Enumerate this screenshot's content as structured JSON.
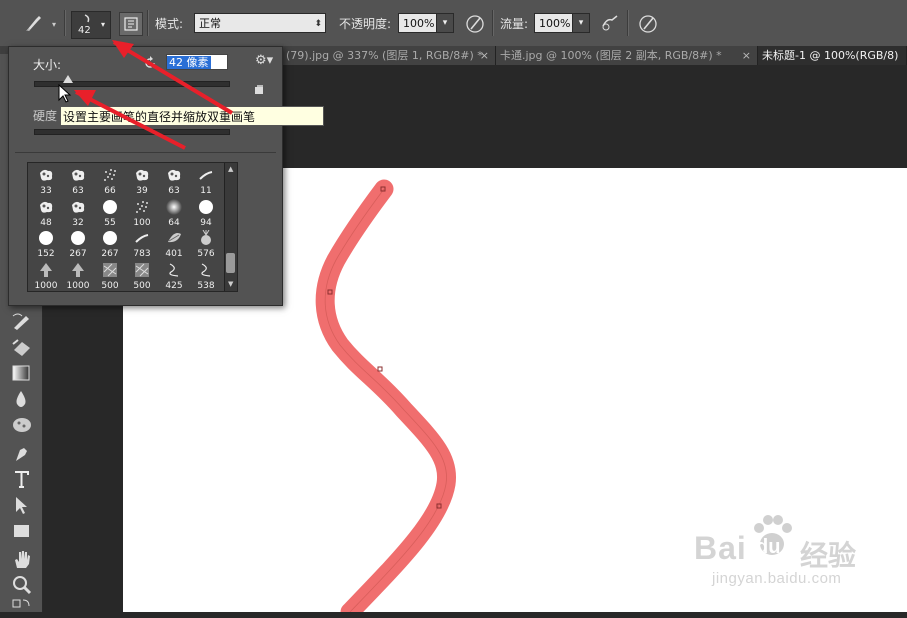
{
  "options_bar": {
    "brush_size_value": "42",
    "mode_label": "模式:",
    "mode_value": "正常",
    "opacity_label": "不透明度:",
    "opacity_value": "100%",
    "flow_label": "流量:",
    "flow_value": "100%"
  },
  "tabs": [
    {
      "label": "(79).jpg @ 337% (图层 1, RGB/8#) *",
      "close": "×",
      "active": false
    },
    {
      "label": "卡通.jpg @ 100% (图层 2 副本, RGB/8#) *",
      "close": "×",
      "active": false
    },
    {
      "label": "未标题-1 @ 100%(RGB/8)",
      "close": "",
      "active": true
    }
  ],
  "brush_popup": {
    "size_label": "大小:",
    "size_value": "42 像素",
    "size_fraction": 0.17,
    "hardness_label": "硬度",
    "tooltip": "设置主要画笔的直径并缩放双重画笔",
    "presets": [
      {
        "num": "33",
        "kind": "splatter"
      },
      {
        "num": "63",
        "kind": "splatter"
      },
      {
        "num": "66",
        "kind": "spray"
      },
      {
        "num": "39",
        "kind": "splatter"
      },
      {
        "num": "63",
        "kind": "splatter"
      },
      {
        "num": "11",
        "kind": "stroke"
      },
      {
        "num": "48",
        "kind": "splatter"
      },
      {
        "num": "32",
        "kind": "splatter"
      },
      {
        "num": "55",
        "kind": "hard-round"
      },
      {
        "num": "100",
        "kind": "spray"
      },
      {
        "num": "64",
        "kind": "soft-round"
      },
      {
        "num": "94",
        "kind": "hard-round"
      },
      {
        "num": "152",
        "kind": "hard-round"
      },
      {
        "num": "267",
        "kind": "hard-round"
      },
      {
        "num": "267",
        "kind": "hard-round"
      },
      {
        "num": "783",
        "kind": "stroke"
      },
      {
        "num": "401",
        "kind": "leaf"
      },
      {
        "num": "576",
        "kind": "pineapple"
      },
      {
        "num": "1000",
        "kind": "tree"
      },
      {
        "num": "1000",
        "kind": "tree"
      },
      {
        "num": "500",
        "kind": "texture"
      },
      {
        "num": "500",
        "kind": "texture"
      },
      {
        "num": "425",
        "kind": "curve"
      },
      {
        "num": "538",
        "kind": "curve"
      }
    ]
  },
  "colors": {
    "stroke": "#f06e6e",
    "arrow": "#e8202a",
    "canvas": "#ffffff",
    "panel": "#535353"
  },
  "watermark": {
    "brand_a": "Bai",
    "brand_b": "du",
    "brand_cn": "经验",
    "url": "jingyan.baidu.com"
  }
}
